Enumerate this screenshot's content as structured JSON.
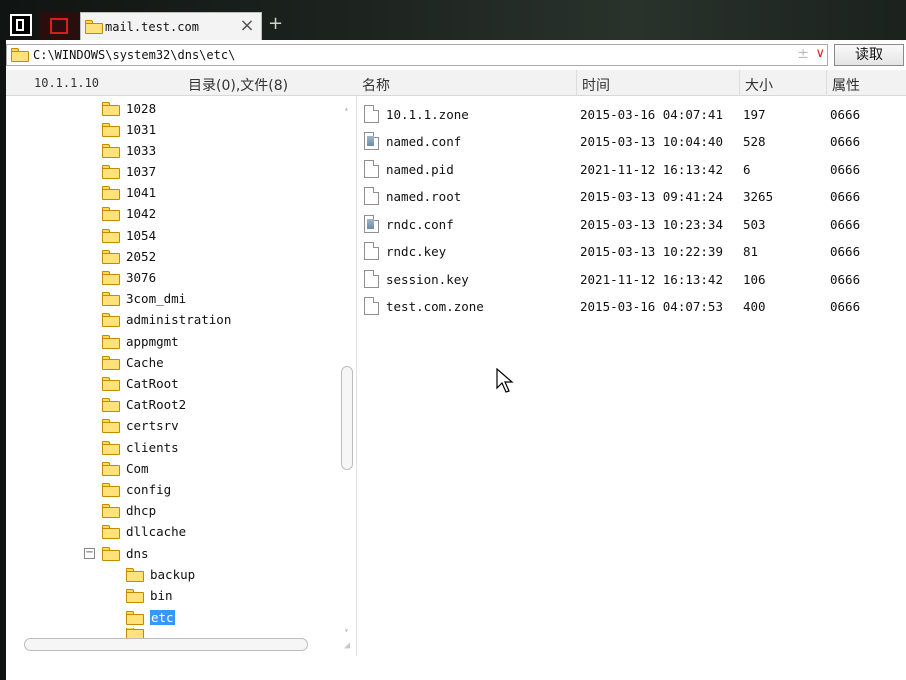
{
  "tabs": [
    {
      "label": "mail.test.com",
      "active": true
    }
  ],
  "address": {
    "path": "C:\\WINDOWS\\system32\\dns\\etc\\",
    "read_button": "读取",
    "plus_glyph": "±",
    "chevron_glyph": "∨"
  },
  "header": {
    "host": "10.1.1.10",
    "summary": "目录(0),文件(8)",
    "col_name": "名称",
    "col_time": "时间",
    "col_size": "大小",
    "col_attr": "属性"
  },
  "tree": {
    "items": [
      {
        "label": "1028"
      },
      {
        "label": "1031"
      },
      {
        "label": "1033"
      },
      {
        "label": "1037"
      },
      {
        "label": "1041"
      },
      {
        "label": "1042"
      },
      {
        "label": "1054"
      },
      {
        "label": "2052"
      },
      {
        "label": "3076"
      },
      {
        "label": "3com_dmi"
      },
      {
        "label": "administration"
      },
      {
        "label": "appmgmt"
      },
      {
        "label": "Cache"
      },
      {
        "label": "CatRoot"
      },
      {
        "label": "CatRoot2"
      },
      {
        "label": "certsrv"
      },
      {
        "label": "clients"
      },
      {
        "label": "Com"
      },
      {
        "label": "config"
      },
      {
        "label": "dhcp"
      },
      {
        "label": "dllcache"
      },
      {
        "label": "dns",
        "expanded": true
      },
      {
        "label": "backup",
        "child": true
      },
      {
        "label": "bin",
        "child": true
      },
      {
        "label": "etc",
        "child": true,
        "selected": true
      }
    ]
  },
  "files": [
    {
      "name": "10.1.1.zone",
      "time": "2015-03-16 04:07:41",
      "size": "197",
      "attr": "0666",
      "icon": "file-icon"
    },
    {
      "name": "named.conf",
      "time": "2015-03-13 10:04:40",
      "size": "528",
      "attr": "0666",
      "icon": "config-file-icon"
    },
    {
      "name": "named.pid",
      "time": "2021-11-12 16:13:42",
      "size": "6",
      "attr": "0666",
      "icon": "file-icon"
    },
    {
      "name": "named.root",
      "time": "2015-03-13 09:41:24",
      "size": "3265",
      "attr": "0666",
      "icon": "file-icon"
    },
    {
      "name": "rndc.conf",
      "time": "2015-03-13 10:23:34",
      "size": "503",
      "attr": "0666",
      "icon": "config-file-icon"
    },
    {
      "name": "rndc.key",
      "time": "2015-03-13 10:22:39",
      "size": "81",
      "attr": "0666",
      "icon": "file-icon"
    },
    {
      "name": "session.key",
      "time": "2021-11-12 16:13:42",
      "size": "106",
      "attr": "0666",
      "icon": "file-icon"
    },
    {
      "name": "test.com.zone",
      "time": "2015-03-16 04:07:53",
      "size": "400",
      "attr": "0666",
      "icon": "file-icon"
    }
  ],
  "colors": {
    "selection": "#3399ff",
    "folder": "#ffe27a",
    "close_red": "#e01b1b"
  }
}
